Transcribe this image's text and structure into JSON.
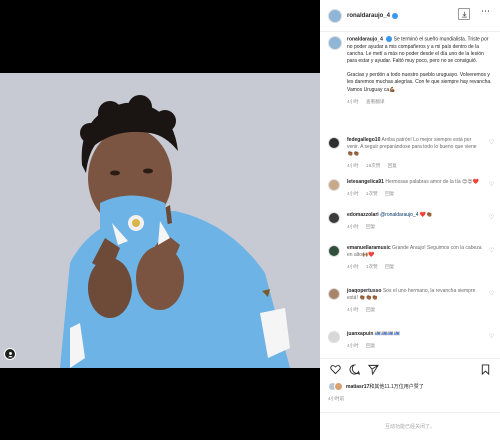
{
  "post": {
    "username": "ronaldaraujo_4",
    "icons": {
      "more": "more-horizontal-icon",
      "save": "download-icon",
      "tag": "user-tag-icon"
    }
  },
  "caption": {
    "username": "ronaldaraujo_4",
    "text_1": "Se terminó el sueño mundialista. Triste por no poder ayudar a mis compañeros y a mi país dentro de la cancha. Le metí a más no poder desde el día uno de la lesión para estar y ayudar. Faltó muy poco, pero no se consiguió.",
    "text_2": "Gracias y perdón a todo nuestro pueblo uruguayo. Volveremos y les daremos muchas alegrías. Con fe que siempre hay revancha. Vamos Uruguay ca💪🏾",
    "time": "4小时",
    "translate": "查看翻译"
  },
  "comments": [
    {
      "user": "fedegallego10",
      "text": "Arriba patrón! Lo mejor siempre está por venir. A seguir preparándose para todo lo bueno que viene 👏🏾👏🏾",
      "time": "4小时",
      "likes": "18次赞",
      "extra": "回复"
    },
    {
      "user": "letesangelica91",
      "text": "Hermosas palabras amor de la tía 😍😍❤️",
      "time": "4小时",
      "likes": "1次赞",
      "extra": "回复"
    },
    {
      "user": "edomazzolari",
      "text": "@ronaldaraujo_4 ❤️👏🏾",
      "time": "4小时",
      "likes": "",
      "extra": "回复"
    },
    {
      "user": "emanuellaramusic",
      "text": "Grande Araujo! Seguimos con la cabeza en alto🙌🏾❤️",
      "time": "4小时",
      "likes": "1次赞",
      "extra": "回复"
    },
    {
      "user": "joaqopertusso",
      "text": "Sos el uno hermano, la revancha siempre está! 👏🏾👏🏾👏🏾",
      "time": "4小时",
      "likes": "",
      "extra": "回复"
    },
    {
      "user": "juanxapuin",
      "text": "🇺🇾🇺🇾🇺🇾🇺🇾",
      "time": "4小时",
      "likes": "",
      "extra": "回复"
    }
  ],
  "likes": {
    "user": "matiasr17",
    "rest": "和其他11.1万位用户赞了"
  },
  "posted_time": "4小时前",
  "add_comment_placeholder": "互动功能已经关闭了。",
  "colors": {
    "verified": "#3897f0",
    "jersey": "#6db3e6"
  }
}
